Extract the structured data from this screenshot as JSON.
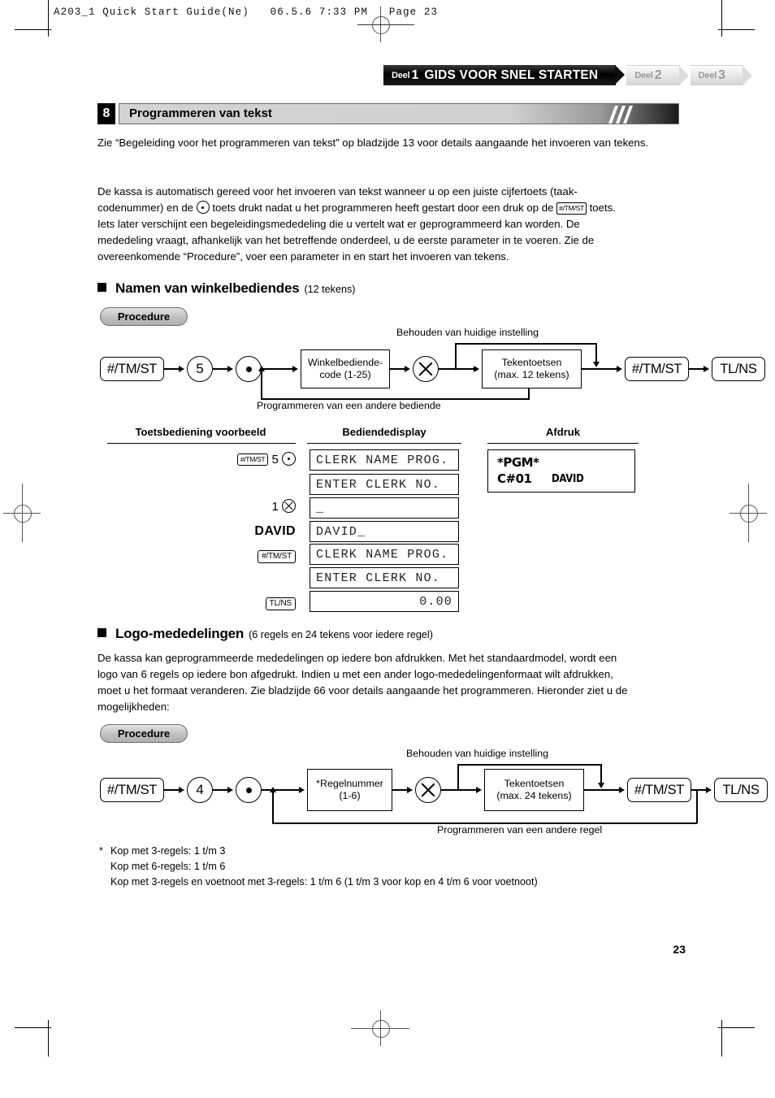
{
  "print_header": {
    "text": "A203_1 Quick Start Guide(Ne)   06.5.6 7:33 PM   Page 23"
  },
  "deel_tabs": [
    {
      "small": "Deel",
      "num": "1",
      "title": "GIDS VOOR SNEL STARTEN",
      "active": true
    },
    {
      "small": "Deel",
      "num": "2",
      "title": "",
      "active": false
    },
    {
      "small": "Deel",
      "num": "3",
      "title": "",
      "active": false
    }
  ],
  "section": {
    "number": "8",
    "title": "Programmeren van tekst"
  },
  "intro": {
    "p1": "Zie “Begeleiding voor het programmeren van tekst” op bladzijde 13 voor details aangaande het invoeren van tekens.",
    "p2_a": "De kassa is automatisch gereed voor het invoeren van tekst wanneer u op een juiste cijfertoets (taak-",
    "p2_b1": "codenummer) en de",
    "p2_key_dot": "dot-key",
    "p2_b2": "toets drukt nadat u het programmeren heeft gestart door een druk op de",
    "p2_key_tmst": "#/TM/ST",
    "p2_b3": "toets.",
    "p2_c": "Iets later verschijnt een begeleidingsmededeling die u vertelt wat er geprogrammeerd kan worden. De",
    "p2_d": "mededeling vraagt, afhankelijk van het betreffende onderdeel, u de eerste parameter in te voeren. Zie de",
    "p2_e": "overeenkomende “Procedure”, voer een parameter in en start het invoeren van tekens."
  },
  "clerk_section": {
    "heading": "Namen van winkelbediendes",
    "heading_sub": "(12 tekens)",
    "procedure_label": "Procedure",
    "flow": {
      "top_caption": "Behouden van huidige instelling",
      "bottom_caption": "Programmeren van een andere bediende",
      "n1": "#/TM/ST",
      "n2": "5",
      "n3": "dot-key",
      "n4_l1": "Winkelbediende-",
      "n4_l2": "code (1-25)",
      "n5": "x-key",
      "n6_l1": "Tekentoetsen",
      "n6_l2": "(max. 12 tekens)",
      "n7": "#/TM/ST",
      "n8": "TL/NS"
    },
    "table": {
      "headers": [
        "Toetsbediening voorbeeld",
        "Bediendedisplay",
        "Afdruk"
      ],
      "rows": [
        {
          "op_key": "#/TM/ST",
          "op_text": "5",
          "op_icon": "dot",
          "display": "CLERK NAME PROG.",
          "align": "left"
        },
        {
          "op_key": "",
          "op_text": "",
          "op_icon": "",
          "display": "ENTER CLERK NO.",
          "align": "left"
        },
        {
          "op_key": "",
          "op_text": "1",
          "op_icon": "x",
          "display": "_",
          "align": "left"
        },
        {
          "op_key": "",
          "op_text": "DAVID",
          "op_icon": "",
          "display": "DAVID_",
          "align": "left"
        },
        {
          "op_key": "#/TM/ST",
          "op_text": "",
          "op_icon": "",
          "display": "CLERK NAME PROG.",
          "align": "left"
        },
        {
          "op_key": "",
          "op_text": "",
          "op_icon": "",
          "display": "ENTER CLERK NO.",
          "align": "left"
        },
        {
          "op_key": "TL/NS",
          "op_text": "",
          "op_icon": "",
          "display": "0.00",
          "align": "right"
        }
      ],
      "receipt": {
        "line1": "*PGM*",
        "line2_left": "C#01",
        "line2_right": "DAVID"
      }
    }
  },
  "logo_section": {
    "heading": "Logo-mededelingen",
    "heading_sub": "(6 regels en 24 tekens voor iedere regel)",
    "body_l1": "De kassa kan geprogrammeerde mededelingen op iedere bon afdrukken. Met het standaardmodel, wordt een",
    "body_l2": "logo van 6 regels op iedere bon afgedrukt. Indien u met een ander logo-mededelingenformaat wilt afdrukken,",
    "body_l3": "moet u het formaat veranderen. Zie bladzijde 66 voor details aangaande het programmeren. Hieronder ziet u de",
    "body_l4": "mogelijkheden:",
    "procedure_label": "Procedure",
    "flow": {
      "top_caption": "Behouden van huidige instelling",
      "bottom_caption": "Programmeren van een andere regel",
      "n1": "#/TM/ST",
      "n2": "4",
      "n3": "dot-key",
      "n4_l1": "*Regelnummer",
      "n4_l2": "(1-6)",
      "n5": "x-key",
      "n6_l1": "Tekentoetsen",
      "n6_l2": "(max. 24 tekens)",
      "n7": "#/TM/ST",
      "n8": "TL/NS"
    },
    "footnote_marker": "*",
    "footnote_l1": "Kop met 3-regels: 1 t/m 3",
    "footnote_l2": "Kop met 6-regels: 1 t/m 6",
    "footnote_l3": "Kop met 3-regels en voetnoot met 3-regels: 1 t/m 6 (1 t/m 3 voor kop en 4 t/m 6 voor voetnoot)"
  },
  "page_number": "23"
}
